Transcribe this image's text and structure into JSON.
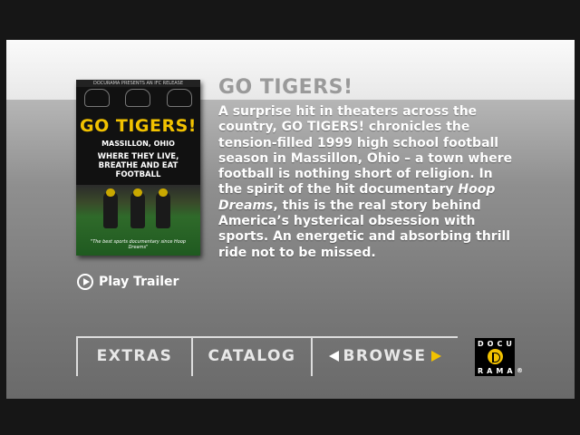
{
  "movie": {
    "title": "GO TIGERS!",
    "description_pre": "A surprise hit in theaters across the country, GO TIGERS! chronicles the tension-filled 1999 high school football season in Massillon, Ohio – a town where football is nothing short of religion. In the spirit of the hit documentary ",
    "description_italic": "Hoop Dreams",
    "description_post": ", this is the real story behind America’s hysterical obsession with sports.  An energetic and absorbing thrill ride not to be missed."
  },
  "cover": {
    "top_strip": "DOCURAMA PRESENTS AN IFC RELEASE",
    "title": "GO TIGERS!",
    "location": "MASSILLON, OHIO",
    "tagline": "WHERE THEY LIVE, BREATHE AND EAT FOOTBALL",
    "quote": "\"The best sports documentary since Hoop Dreams\""
  },
  "trailer": {
    "label": "Play Trailer"
  },
  "nav": {
    "extras": "EXTRAS",
    "catalog": "CATALOG",
    "browse": "BROWSE"
  },
  "logo": {
    "row1": "DOCU",
    "row2": "RAMA",
    "mark": "®"
  },
  "colors": {
    "accent": "#f2c200",
    "title_gray": "#9a9a9a"
  }
}
